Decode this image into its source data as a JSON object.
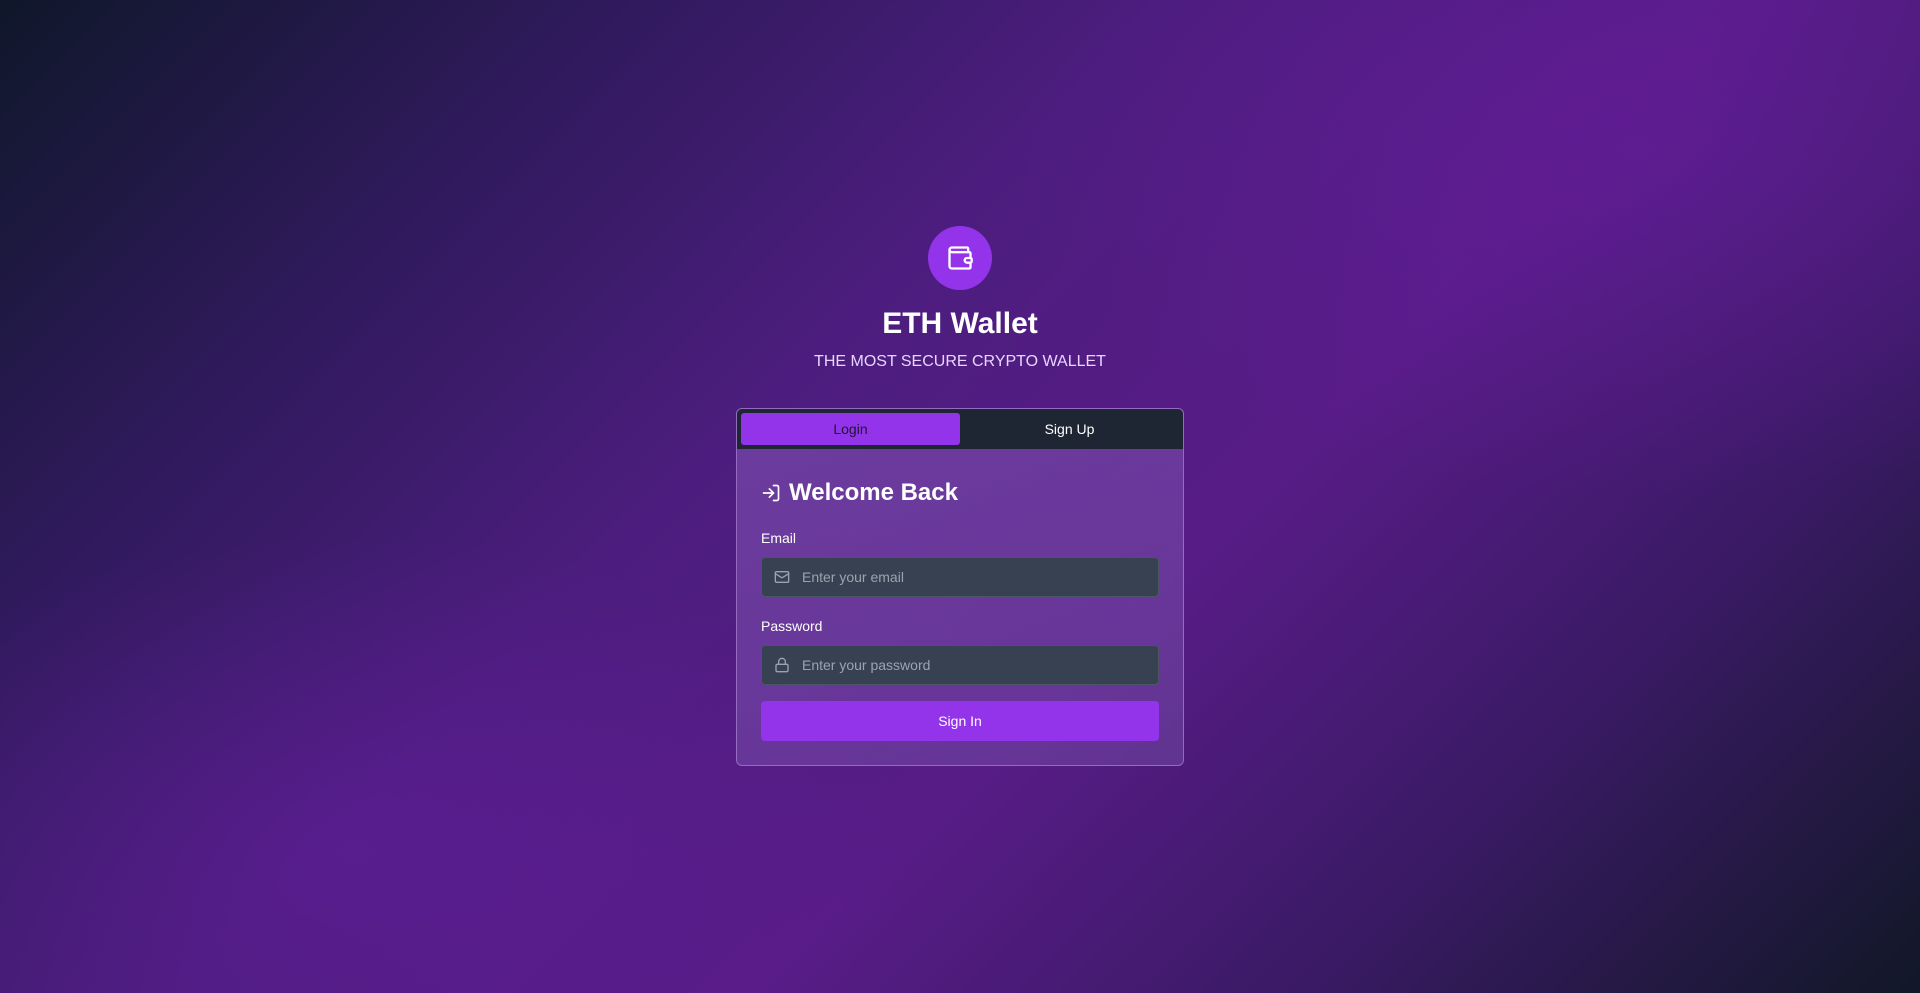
{
  "app": {
    "title": "ETH Wallet",
    "subtitle": "THE MOST SECURE CRYPTO WALLET",
    "logo_icon": "wallet-icon",
    "accent_color": "#9333ea"
  },
  "tabs": [
    {
      "label": "Login",
      "active": true
    },
    {
      "label": "Sign Up",
      "active": false
    }
  ],
  "login_form": {
    "heading": "Welcome Back",
    "heading_icon": "log-in-icon",
    "email": {
      "label": "Email",
      "placeholder": "Enter your email",
      "value": "",
      "icon": "mail-icon"
    },
    "password": {
      "label": "Password",
      "placeholder": "Enter your password",
      "value": "",
      "icon": "lock-icon"
    },
    "submit_label": "Sign In"
  }
}
